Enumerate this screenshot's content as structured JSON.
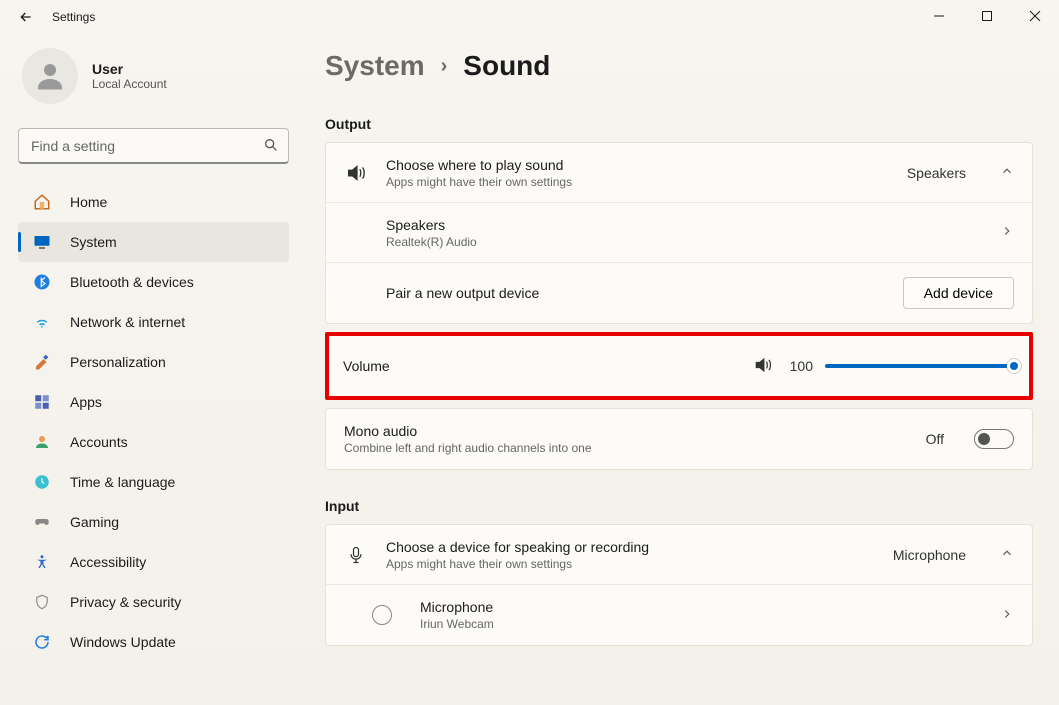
{
  "window": {
    "title": "Settings"
  },
  "user": {
    "name": "User",
    "account_type": "Local Account"
  },
  "search": {
    "placeholder": "Find a setting"
  },
  "nav": {
    "items": [
      {
        "label": "Home"
      },
      {
        "label": "System"
      },
      {
        "label": "Bluetooth & devices"
      },
      {
        "label": "Network & internet"
      },
      {
        "label": "Personalization"
      },
      {
        "label": "Apps"
      },
      {
        "label": "Accounts"
      },
      {
        "label": "Time & language"
      },
      {
        "label": "Gaming"
      },
      {
        "label": "Accessibility"
      },
      {
        "label": "Privacy & security"
      },
      {
        "label": "Windows Update"
      }
    ],
    "active_index": 1
  },
  "breadcrumb": {
    "parent": "System",
    "current": "Sound"
  },
  "output": {
    "section_label": "Output",
    "choose_title": "Choose where to play sound",
    "choose_sub": "Apps might have their own settings",
    "choose_value": "Speakers",
    "device_name": "Speakers",
    "device_sub": "Realtek(R) Audio",
    "pair_label": "Pair a new output device",
    "add_button": "Add device"
  },
  "volume": {
    "label": "Volume",
    "value": "100"
  },
  "mono": {
    "title": "Mono audio",
    "sub": "Combine left and right audio channels into one",
    "state": "Off"
  },
  "input": {
    "section_label": "Input",
    "choose_title": "Choose a device for speaking or recording",
    "choose_sub": "Apps might have their own settings",
    "choose_value": "Microphone",
    "device_name": "Microphone",
    "device_sub": "Iriun Webcam"
  }
}
